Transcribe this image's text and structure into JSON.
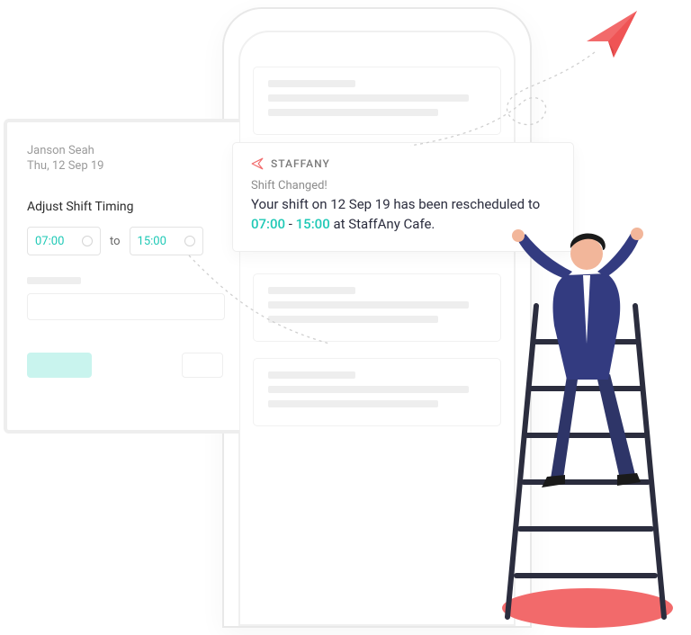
{
  "panel": {
    "user_name": "Janson Seah",
    "user_date": "Thu, 12 Sep 19",
    "section_title": "Adjust Shift Timing",
    "time_from": "07:00",
    "time_sep": "to",
    "time_to": "15:00"
  },
  "notification": {
    "brand": "STAFFANY",
    "title": "Shift Changed!",
    "body_pre": "Your shift on 12 Sep 19 has been rescheduled to ",
    "time_from": "07:00",
    "dash": " - ",
    "time_to": "15:00",
    "body_post": " at StaffAny Cafe."
  }
}
